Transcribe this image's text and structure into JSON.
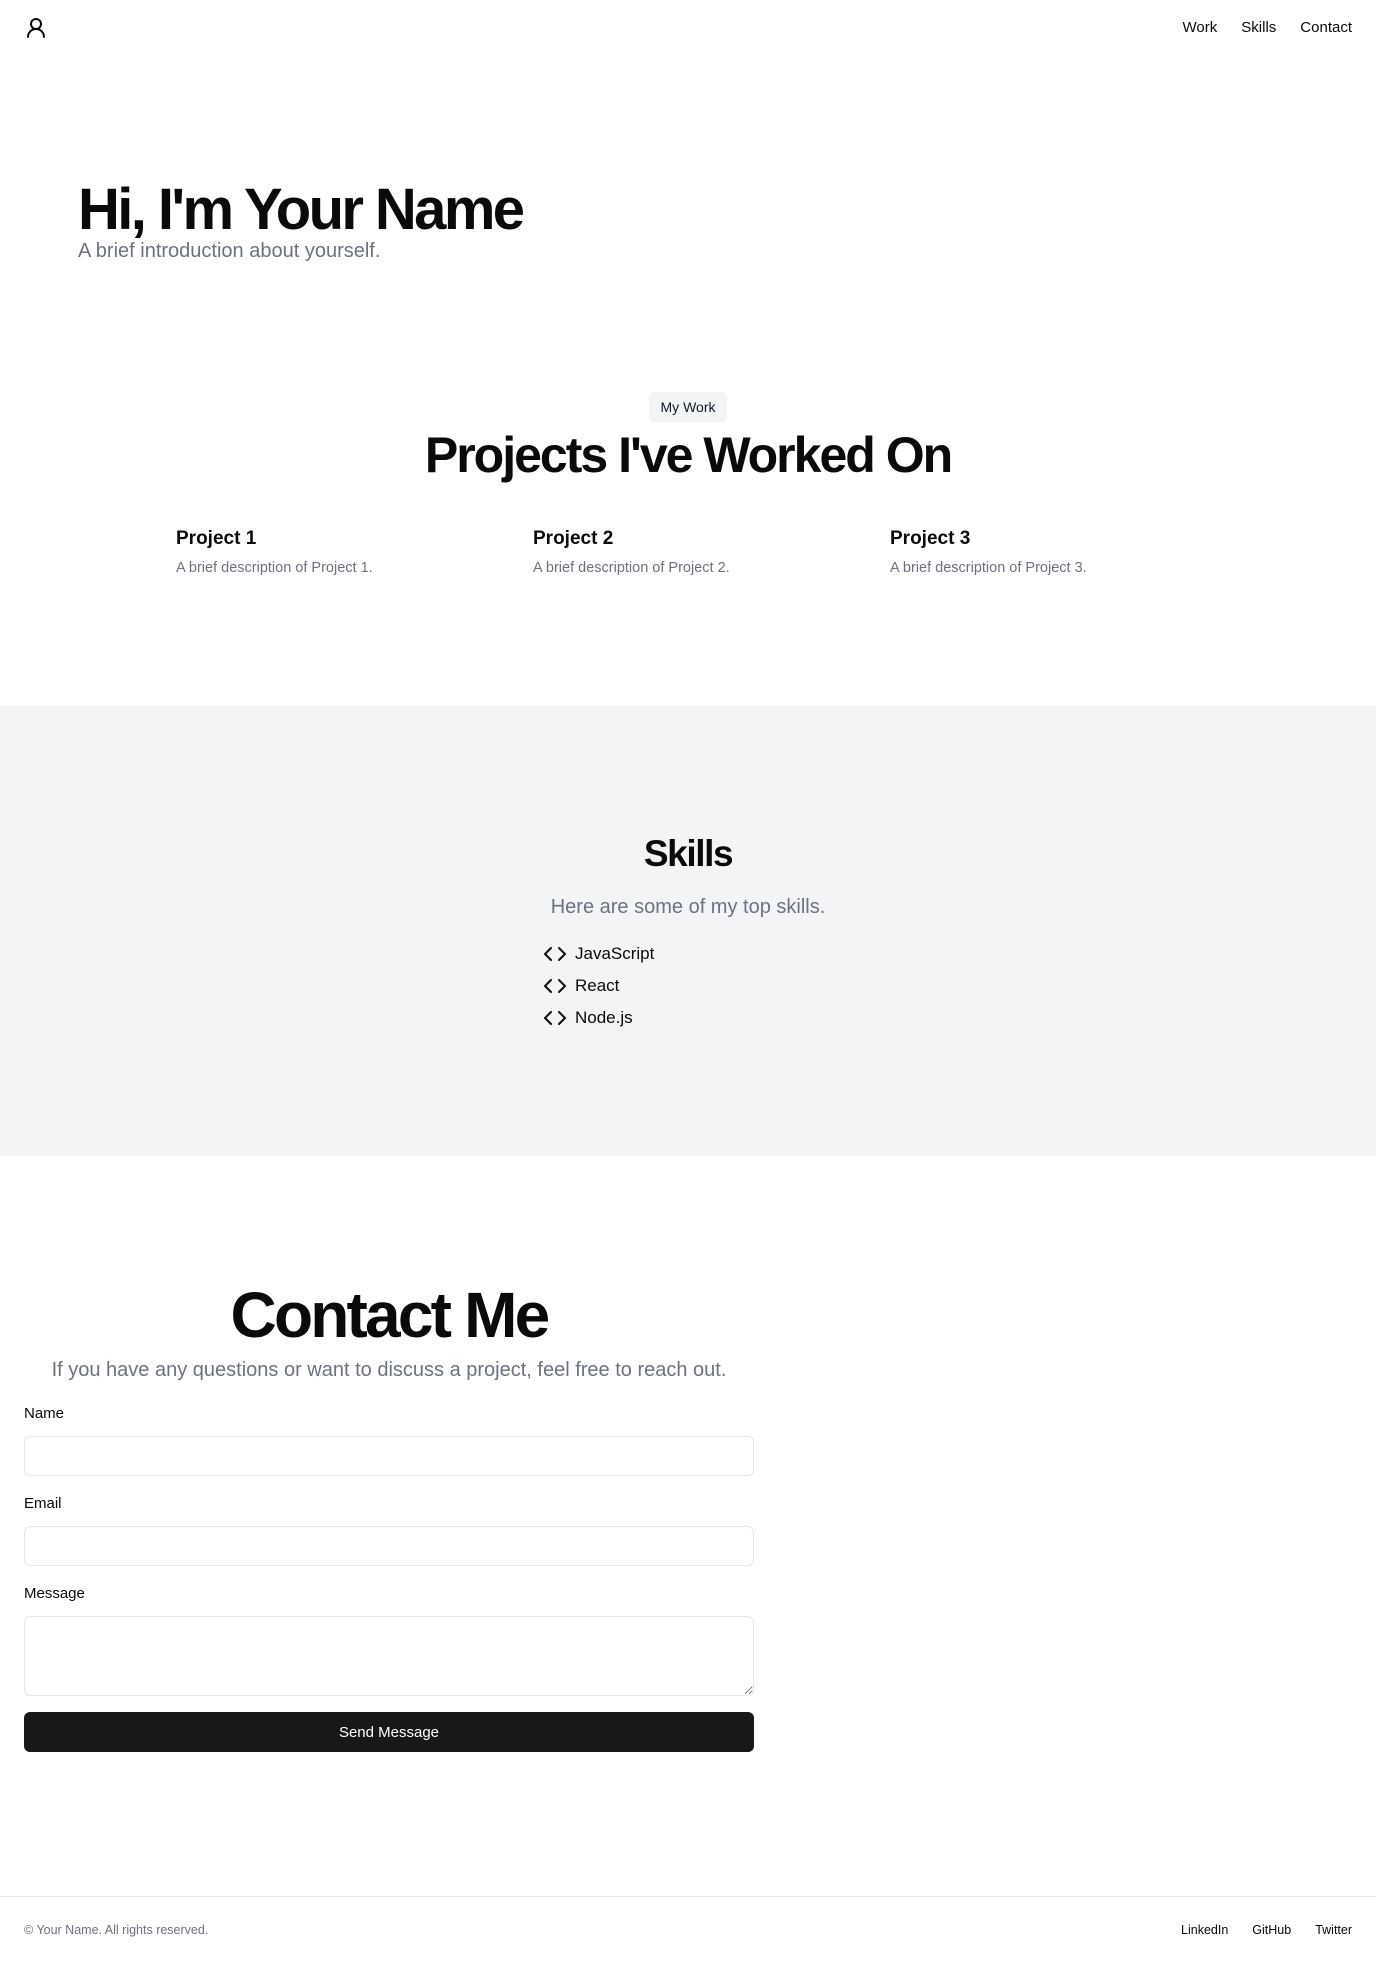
{
  "header": {
    "logo_icon": "user-icon",
    "nav": [
      "Work",
      "Skills",
      "Contact"
    ]
  },
  "hero": {
    "title": "Hi, I'm Your Name",
    "subtitle": "A brief introduction about yourself."
  },
  "work": {
    "badge": "My Work",
    "title": "Projects I've Worked On",
    "projects": [
      {
        "title": "Project 1",
        "description": "A brief description of Project 1."
      },
      {
        "title": "Project 2",
        "description": "A brief description of Project 2."
      },
      {
        "title": "Project 3",
        "description": "A brief description of Project 3."
      }
    ]
  },
  "skills": {
    "title": "Skills",
    "subtitle": "Here are some of my top skills.",
    "icon": "code-icon",
    "items": [
      "JavaScript",
      "React",
      "Node.js"
    ]
  },
  "contact": {
    "title": "Contact Me",
    "subtitle": "If you have any questions or want to discuss a project, feel free to reach out.",
    "name_label": "Name",
    "name_value": "",
    "email_label": "Email",
    "email_value": "",
    "message_label": "Message",
    "message_value": "",
    "submit_label": "Send Message"
  },
  "footer": {
    "copyright": "© Your Name. All rights reserved.",
    "links": [
      "LinkedIn",
      "GitHub",
      "Twitter"
    ]
  },
  "colors": {
    "text": "#0a0a0a",
    "muted": "#6b7280",
    "section_bg": "#f3f4f6",
    "button_bg": "#18181b",
    "border": "#e5e7eb"
  }
}
